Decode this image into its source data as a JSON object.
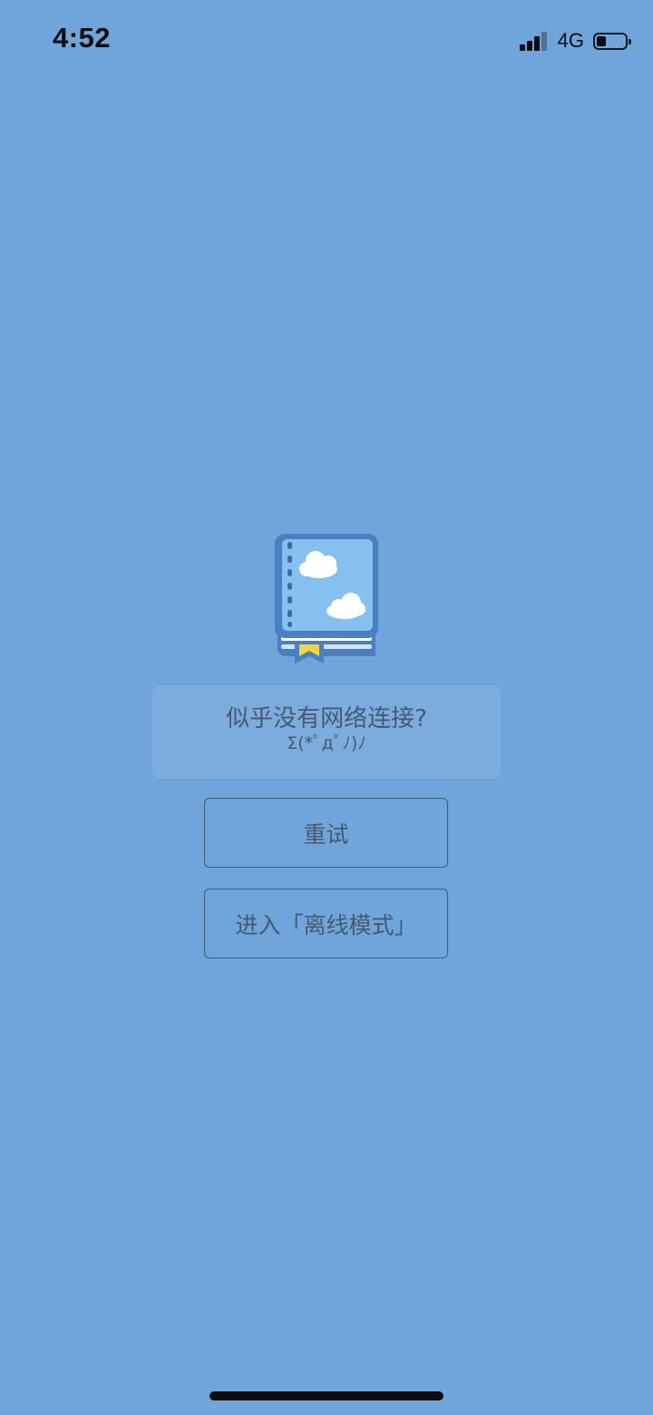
{
  "status_bar": {
    "time": "4:52",
    "network": "4G",
    "signal_icon": "cellular-signal-icon",
    "battery_icon": "battery-icon"
  },
  "illustration": {
    "icon": "book-icon"
  },
  "message": {
    "title": "似乎没有网络连接?",
    "emoticon": "Σ(*ﾟдﾟﾉ)ﾉ"
  },
  "buttons": {
    "retry_label": "重试",
    "offline_label": "进入「离线模式」"
  },
  "colors": {
    "background": "#6fa5db",
    "text": "#445a70",
    "button_border": "#3f5c7a",
    "message_box": "#7cacdd"
  }
}
